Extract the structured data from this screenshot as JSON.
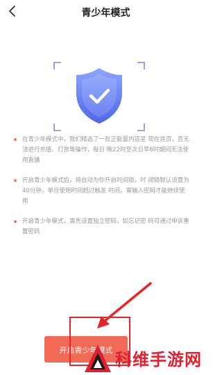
{
  "header": {
    "title": "青少年模式",
    "back_icon": "chevron-left-icon"
  },
  "hero": {
    "icon": "shield-check-icon"
  },
  "tips": [
    "在青少年模式中，我们精选了一批正能量内容呈 现在首页，且无法进行充值、打赏等操作，每日 晚22时至次日早6时期间无法使用直播",
    "开启青少年模式后，将自动为你开启时间锁，时 间锁默认设置为40分钟，单日使用时间超过触发 时间，需输入密码才能继续使用",
    "开启青少年模式，需先设置独立密码，如忘记密 码可通过申诉重置密码"
  ],
  "actions": {
    "enable_label": "开启青少年模式"
  },
  "watermark": {
    "text": "科维手游网"
  },
  "colors": {
    "accent": "#f26a55",
    "annotation": "#e5252a",
    "shield_top": "#8aa6ff",
    "shield_bottom": "#4f66e8"
  }
}
